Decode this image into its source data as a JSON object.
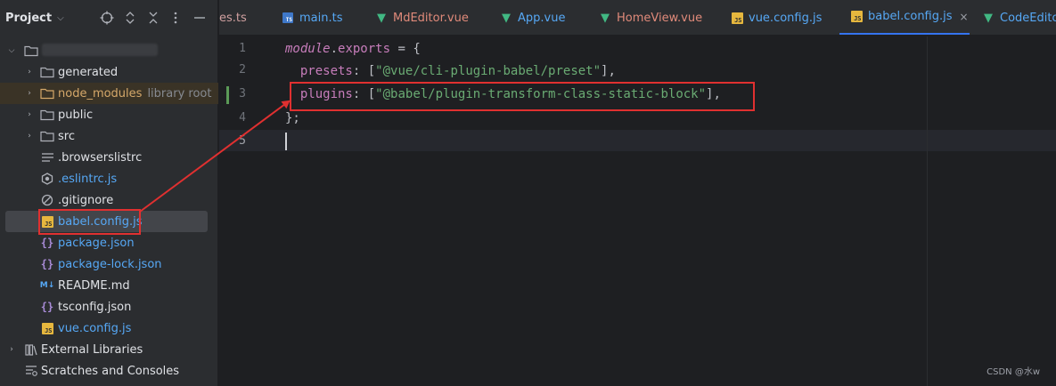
{
  "sidebar": {
    "title": "Project",
    "tools": [
      "locate-icon",
      "expand-icon",
      "collapse-icon",
      "more-icon",
      "minimize-icon"
    ],
    "root": {
      "label": "(blurred project name)"
    },
    "items": [
      {
        "label": "generated",
        "type": "folder"
      },
      {
        "label": "node_modules",
        "hint": "library root",
        "type": "folder"
      },
      {
        "label": "public",
        "type": "folder"
      },
      {
        "label": "src",
        "type": "folder"
      },
      {
        "label": ".browserslistrc",
        "type": "file"
      },
      {
        "label": ".eslintrc.js",
        "type": "file"
      },
      {
        "label": ".gitignore",
        "type": "file"
      },
      {
        "label": "babel.config.js",
        "type": "file"
      },
      {
        "label": "package.json",
        "type": "file"
      },
      {
        "label": "package-lock.json",
        "type": "file"
      },
      {
        "label": "README.md",
        "type": "file"
      },
      {
        "label": "tsconfig.json",
        "type": "file"
      },
      {
        "label": "vue.config.js",
        "type": "file"
      },
      {
        "label": "External Libraries",
        "type": "special"
      },
      {
        "label": "Scratches and Consoles",
        "type": "special"
      }
    ]
  },
  "tabs": [
    {
      "label": "es.ts",
      "icon": "ts"
    },
    {
      "label": "main.ts",
      "icon": "ts"
    },
    {
      "label": "MdEditor.vue",
      "icon": "vue"
    },
    {
      "label": "App.vue",
      "icon": "vue"
    },
    {
      "label": "HomeView.vue",
      "icon": "vue"
    },
    {
      "label": "vue.config.js",
      "icon": "js"
    },
    {
      "label": "babel.config.js",
      "icon": "js",
      "active": true,
      "close": "×"
    },
    {
      "label": "CodeEditor",
      "icon": "vue"
    }
  ],
  "editor": {
    "line_numbers": [
      "1",
      "2",
      "3",
      "4",
      "5"
    ],
    "code": {
      "l1": {
        "kw": "module",
        "dot": ".",
        "prop": "exports",
        "rest": " = {"
      },
      "l2": {
        "prop": "presets",
        "p1": ": [",
        "str": "\"@vue/cli-plugin-babel/preset\"",
        "p2": "],"
      },
      "l3": {
        "prop": "plugins",
        "p1": ": [",
        "str": "\"@babel/plugin-transform-class-static-block\"",
        "p2": "],"
      },
      "l4": {
        "text": "};"
      }
    }
  },
  "watermark": "CSDN @水w",
  "colors": {
    "accent": "#3574f0",
    "annotation": "#e03030",
    "string": "#6aab73",
    "keyword": "#c77dbb"
  }
}
